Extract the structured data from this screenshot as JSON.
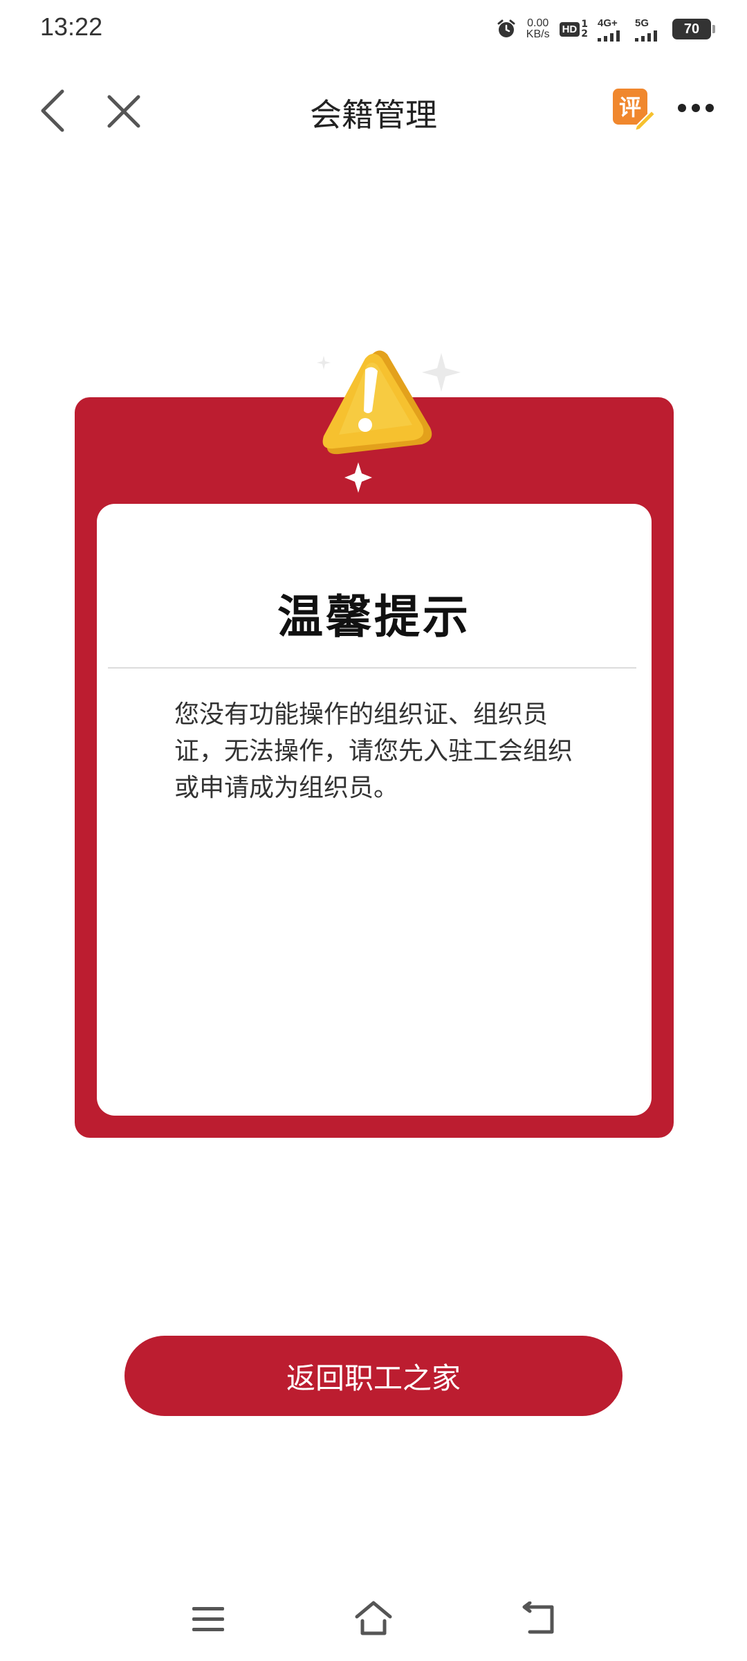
{
  "status_bar": {
    "time": "13:22",
    "net_speed_value": "0.00",
    "net_speed_unit": "KB/s",
    "hd_label": "HD",
    "hd_sub_top": "1",
    "hd_sub_bottom": "2",
    "network_1": "4G+",
    "network_2": "5G",
    "battery": "70"
  },
  "nav": {
    "title": "会籍管理",
    "rate_icon_char": "评"
  },
  "dialog": {
    "title": "温馨提示",
    "message": "您没有功能操作的组织证、组织员证，无法操作，请您先入驻工会组织或申请成为组织员。"
  },
  "actions": {
    "return_button": "返回职工之家"
  },
  "colors": {
    "brand_red": "#bc1d30",
    "warning_yellow": "#f6c12f"
  },
  "icons": {
    "back": "back-chevron-icon",
    "close": "close-icon",
    "rate": "rate-review-icon",
    "more": "more-dots-icon",
    "warning": "warning-triangle-icon",
    "sys_menu": "menu-icon",
    "sys_home": "home-icon",
    "sys_back": "back-icon"
  }
}
